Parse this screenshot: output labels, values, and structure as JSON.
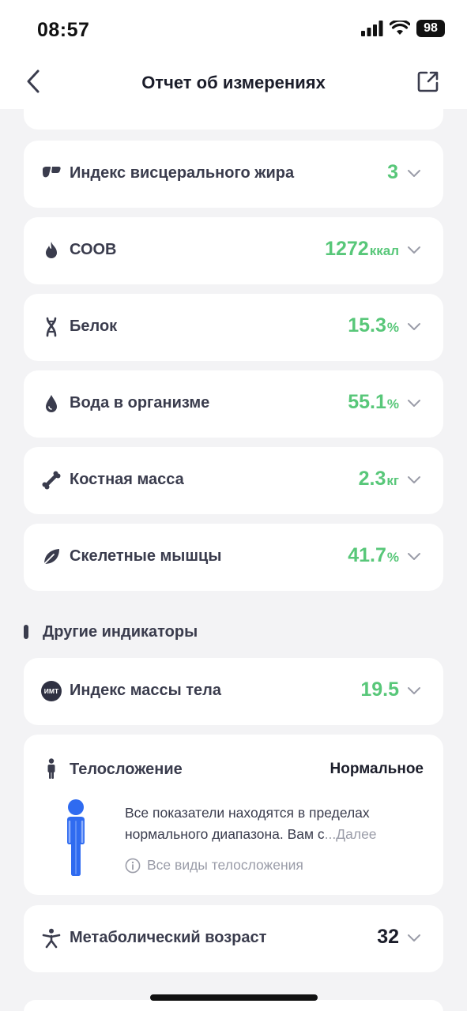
{
  "status_bar": {
    "time": "08:57",
    "battery": "98"
  },
  "nav": {
    "title": "Отчет об измерениях"
  },
  "metrics": [
    {
      "label": "Индекс висцерального жира",
      "value": "3",
      "unit": "",
      "icon": "visceral-fat-icon"
    },
    {
      "label": "СООВ",
      "value": "1272",
      "unit": "ккал",
      "icon": "flame-icon"
    },
    {
      "label": "Белок",
      "value": "15.3",
      "unit": "%",
      "icon": "dna-icon"
    },
    {
      "label": "Вода в организме",
      "value": "55.1",
      "unit": "%",
      "icon": "water-drop-icon"
    },
    {
      "label": "Костная масса",
      "value": "2.3",
      "unit": "кг",
      "icon": "bone-icon"
    },
    {
      "label": "Скелетные мышцы",
      "value": "41.7",
      "unit": "%",
      "icon": "leaf-icon"
    }
  ],
  "other_section": {
    "title": "Другие индикаторы"
  },
  "bmi": {
    "label": "Индекс массы тела",
    "value": "19.5",
    "icon_text": "ИМТ"
  },
  "body_type": {
    "label": "Телосложение",
    "status": "Нормальное",
    "description": "Все показатели находятся в пределах нормального диапазона. Вам с",
    "more": "...Далее",
    "all_types": "Все виды телосложения"
  },
  "metabolic_age": {
    "label": "Метаболический возраст",
    "value": "32"
  },
  "colors": {
    "accent_green": "#58c779",
    "text_dark": "#3a3c4d",
    "figure_blue": "#2f6bf0"
  }
}
